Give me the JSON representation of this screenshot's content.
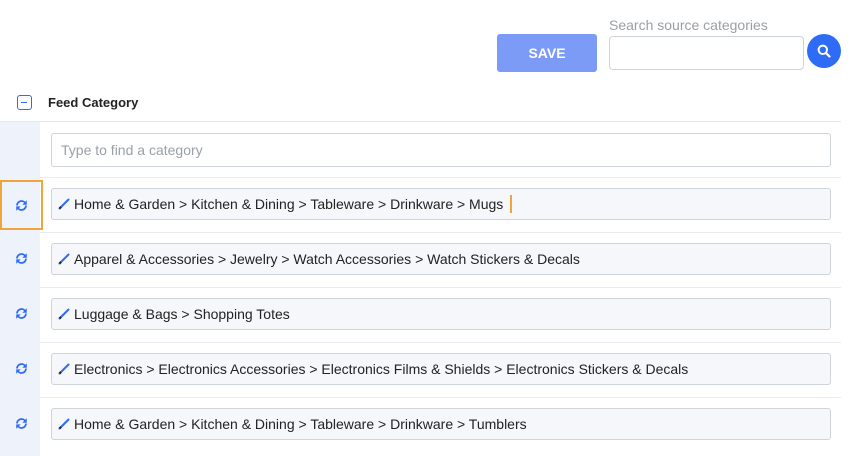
{
  "toolbar": {
    "save_label": "SAVE",
    "search_label": "Search source categories",
    "search_value": ""
  },
  "section": {
    "title": "Feed Category",
    "filter_placeholder": "Type to find a category"
  },
  "categories": [
    {
      "path": "Home & Garden > Kitchen & Dining > Tableware > Drinkware > Mugs",
      "active": true
    },
    {
      "path": "Apparel & Accessories > Jewelry > Watch Accessories > Watch Stickers & Decals",
      "active": false
    },
    {
      "path": "Luggage & Bags > Shopping Totes",
      "active": false
    },
    {
      "path": "Electronics > Electronics Accessories > Electronics Films & Shields > Electronics Stickers & Decals",
      "active": false
    },
    {
      "path": "Home & Garden > Kitchen & Dining > Tableware > Drinkware > Tumblers",
      "active": false
    }
  ],
  "icons": {
    "search": "search-icon",
    "collapse": "minus-square-icon",
    "refresh": "refresh-icon",
    "edit": "pencil-icon"
  },
  "colors": {
    "accent": "#2f6cf6",
    "save_button": "#7b9bf7",
    "highlight": "#f0a53a",
    "left_strip": "#eef2fb"
  }
}
